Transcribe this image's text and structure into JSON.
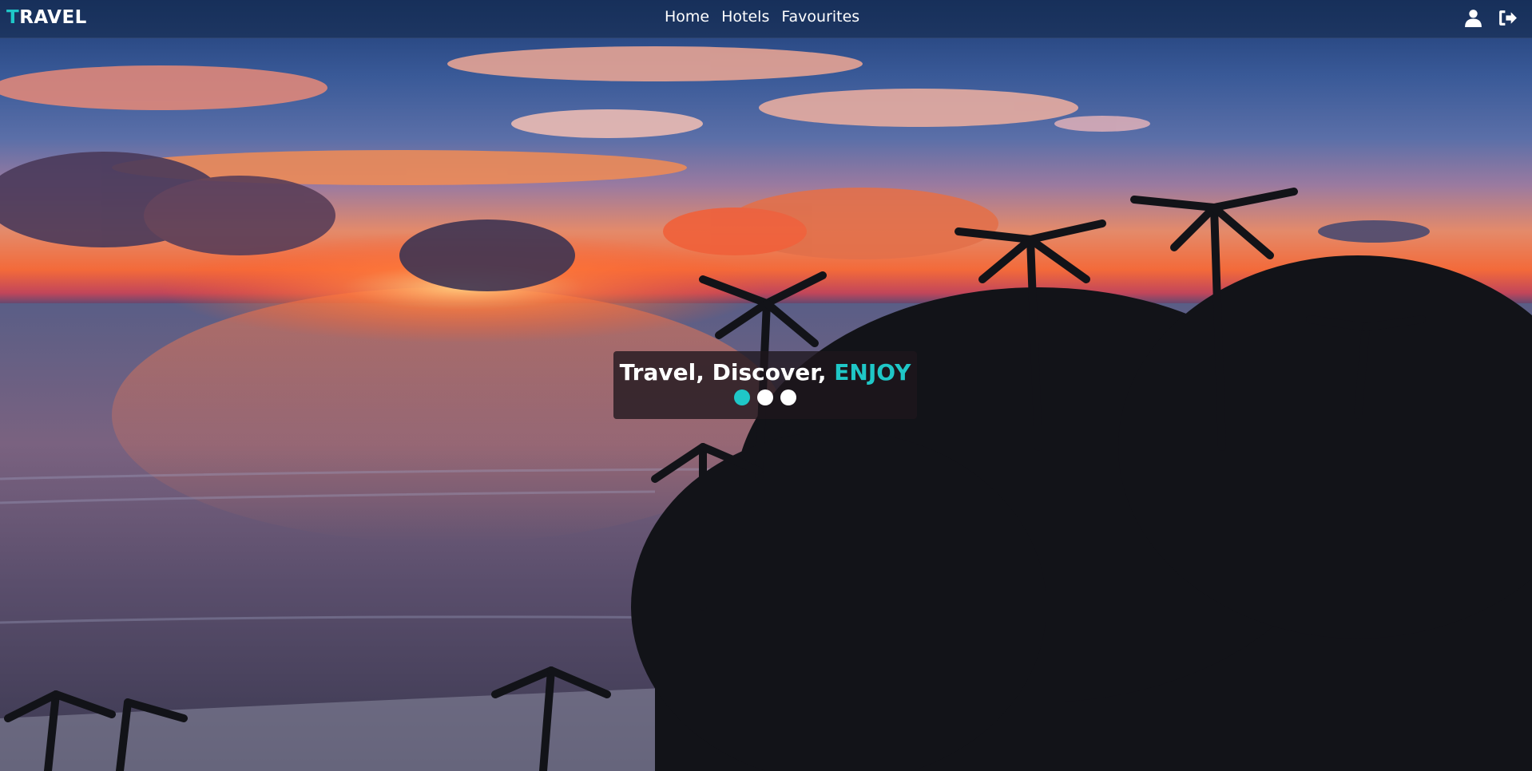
{
  "navbar": {
    "brand_first": "T",
    "brand_rest": "RAVEL",
    "links": [
      {
        "label": "Home"
      },
      {
        "label": "Hotels"
      },
      {
        "label": "Favourites"
      }
    ],
    "icons": [
      "user-icon",
      "logout-icon"
    ]
  },
  "hero": {
    "title_main": "Travel, Discover, ",
    "title_accent": "ENJOY",
    "slides_total": 3,
    "active_slide": 1
  },
  "colors": {
    "accent": "#1fc7c7",
    "navbar_bg": "#122646",
    "text": "#ffffff"
  }
}
